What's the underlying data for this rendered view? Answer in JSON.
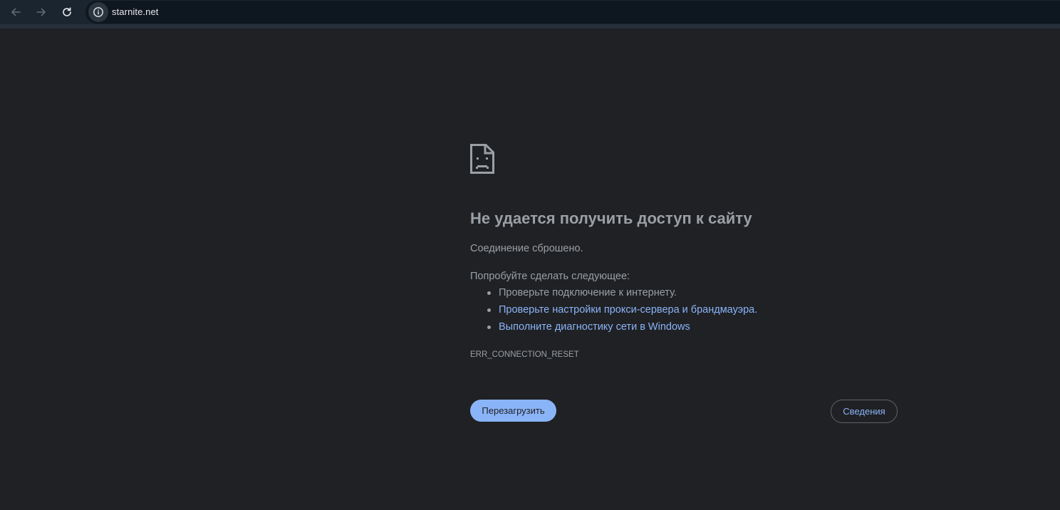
{
  "browser": {
    "url": "starnite.net",
    "icons": {
      "back": "arrow-back-icon",
      "forward": "arrow-forward-icon",
      "reload": "reload-icon",
      "site_info": "info-icon"
    }
  },
  "error_page": {
    "icon": "sad-document-icon",
    "heading": "Не удается получить доступ к сайту",
    "summary": "Соединение сброшено.",
    "suggestions_title": "Попробуйте сделать следующее:",
    "suggestions": [
      {
        "text": "Проверьте подключение к интернету.",
        "is_link": false
      },
      {
        "text": "Проверьте настройки прокси-сервера и брандмауэра.",
        "is_link": true
      },
      {
        "text": "Выполните диагностику сети в Windows",
        "is_link": true
      }
    ],
    "error_code": "ERR_CONNECTION_RESET",
    "reload_label": "Перезагрузить",
    "details_label": "Сведения"
  },
  "colors": {
    "page_background": "#202124",
    "toolbar_background": "#1b2530",
    "omnibox_background": "#0e161f",
    "text_secondary": "#9aa0a6",
    "link": "#8ab4f8",
    "primary_button": "#8ab4f8"
  }
}
